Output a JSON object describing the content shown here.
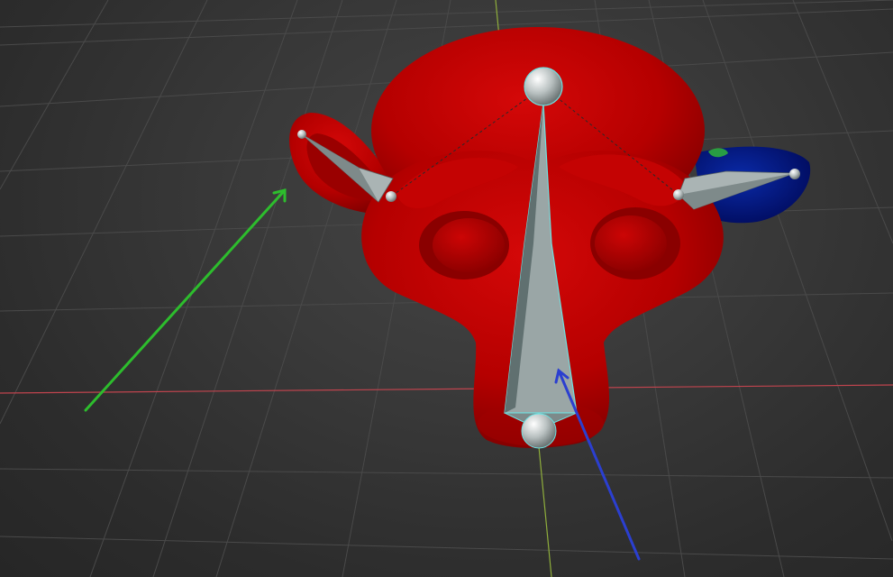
{
  "viewport": {
    "mode": "weight-paint",
    "background": "#3a3a3a",
    "grid_color": "#4a4a4a",
    "x_axis_color": "#c0444e",
    "y_axis_color": "#8fae3c",
    "mesh_color": "#c00000",
    "low_weight_color": "#001a8a",
    "bone_color": "#a8b4b4",
    "arrow_annotation_1_color": "#2dbd2d",
    "arrow_annotation_2_color": "#2b3fd0"
  },
  "objects": {
    "mesh": "monkey-head",
    "armature": "head-armature",
    "bones": [
      "main-bone",
      "left-ear-bone",
      "right-ear-bone"
    ]
  },
  "annotations": [
    "green-arrow",
    "blue-arrow"
  ]
}
